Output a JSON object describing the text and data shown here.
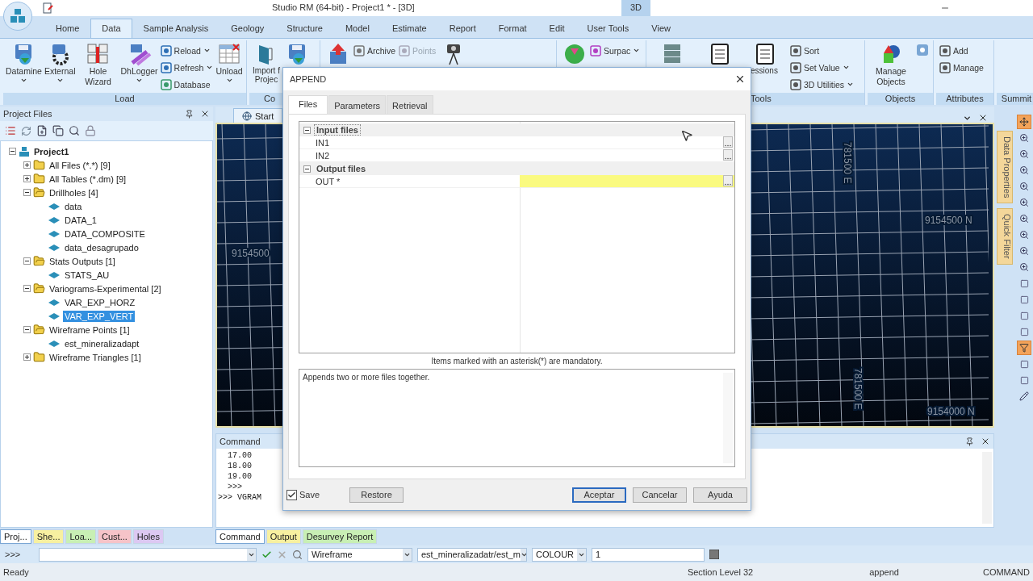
{
  "app": {
    "title": "Studio RM (64-bit) - Project1 * - [3D]",
    "context_tab": "3D"
  },
  "ribbon_tabs": [
    {
      "label": "Home",
      "selected": false
    },
    {
      "label": "Data",
      "selected": true
    },
    {
      "label": "Sample Analysis",
      "selected": false
    },
    {
      "label": "Geology",
      "selected": false
    },
    {
      "label": "Structure",
      "selected": false
    },
    {
      "label": "Model",
      "selected": false
    },
    {
      "label": "Estimate",
      "selected": false
    },
    {
      "label": "Report",
      "selected": false
    },
    {
      "label": "Format",
      "selected": false
    },
    {
      "label": "Edit",
      "selected": false
    },
    {
      "label": "User Tools",
      "selected": false
    },
    {
      "label": "View",
      "selected": false
    }
  ],
  "ribbon_groups": [
    {
      "label": "Load",
      "items": [
        {
          "kind": "large",
          "label": "Datamine",
          "dropdown": true
        },
        {
          "kind": "large",
          "label": "External",
          "dropdown": true
        },
        {
          "kind": "large",
          "label": "Hole Wizard",
          "dropdown": false
        },
        {
          "kind": "large",
          "label": "DhLogger",
          "dropdown": true
        },
        {
          "kind": "stack",
          "entries": [
            {
              "label": "Reload",
              "dropdown": true,
              "disabled": false
            },
            {
              "label": "Refresh",
              "dropdown": true,
              "disabled": false
            },
            {
              "label": "Database",
              "dropdown": false,
              "disabled": false
            }
          ]
        },
        {
          "kind": "large",
          "label": "Unload",
          "dropdown": true
        }
      ]
    },
    {
      "label": "Co",
      "items": [
        {
          "kind": "large",
          "label": "Import f Projec",
          "dropdown": false
        },
        {
          "kind": "icon"
        }
      ]
    },
    {
      "items": [
        {
          "kind": "icon"
        },
        {
          "kind": "stack",
          "entries": [
            {
              "label": "Archive",
              "dropdown": false,
              "disabled": false
            }
          ]
        },
        {
          "kind": "stack",
          "entries": [
            {
              "label": "Points",
              "dropdown": false,
              "disabled": true
            }
          ]
        },
        {
          "kind": "icon"
        }
      ]
    },
    {
      "items": [
        {
          "kind": "icon"
        },
        {
          "kind": "stack",
          "entries": [
            {
              "label": "Surpac",
              "dropdown": true,
              "disabled": false
            }
          ]
        }
      ]
    },
    {
      "label": "Tools",
      "items": [
        {
          "kind": "icon"
        },
        {
          "kind": "icon"
        },
        {
          "kind": "large",
          "label": "essions",
          "dropdown": false
        },
        {
          "kind": "stack",
          "entries": [
            {
              "label": "Sort",
              "dropdown": false,
              "disabled": false
            },
            {
              "label": "Set Value",
              "dropdown": true,
              "disabled": false
            },
            {
              "label": "3D Utilities",
              "dropdown": true,
              "disabled": false
            }
          ]
        }
      ]
    },
    {
      "label": "Objects",
      "items": [
        {
          "kind": "large",
          "label": "Manage Objects",
          "dropdown": false
        },
        {
          "kind": "icon"
        }
      ]
    },
    {
      "label": "Attributes",
      "items": [
        {
          "kind": "stack",
          "entries": [
            {
              "label": "Add",
              "dropdown": false,
              "disabled": false
            },
            {
              "label": "Manage",
              "dropdown": false,
              "disabled": false
            }
          ]
        }
      ]
    },
    {
      "label": "Summit"
    }
  ],
  "project_panel": {
    "title": "Project Files",
    "tree": [
      {
        "label": "Project1",
        "kind": "project",
        "expanded": true,
        "selected": false,
        "children": [
          {
            "label": "All Files (*.*) [9]",
            "kind": "folder",
            "expanded": false,
            "selected": false
          },
          {
            "label": "All Tables (*.dm) [9]",
            "kind": "folder",
            "expanded": false,
            "selected": false
          },
          {
            "label": "Drillholes [4]",
            "kind": "folder",
            "expanded": true,
            "selected": false,
            "children": [
              {
                "label": "data",
                "kind": "table",
                "selected": false
              },
              {
                "label": "DATA_1",
                "kind": "table",
                "selected": false
              },
              {
                "label": "DATA_COMPOSITE",
                "kind": "table",
                "selected": false
              },
              {
                "label": "data_desagrupado",
                "kind": "table",
                "selected": false
              }
            ]
          },
          {
            "label": "Stats Outputs [1]",
            "kind": "folder",
            "expanded": true,
            "selected": false,
            "children": [
              {
                "label": "STATS_AU",
                "kind": "table",
                "selected": false
              }
            ]
          },
          {
            "label": "Variograms-Experimental [2]",
            "kind": "folder",
            "expanded": true,
            "selected": false,
            "children": [
              {
                "label": "VAR_EXP_HORZ",
                "kind": "table",
                "selected": false
              },
              {
                "label": "VAR_EXP_VERT",
                "kind": "table",
                "selected": true
              }
            ]
          },
          {
            "label": "Wireframe Points [1]",
            "kind": "folder",
            "expanded": true,
            "selected": false,
            "children": [
              {
                "label": "est_mineralizadapt",
                "kind": "table",
                "selected": false
              }
            ]
          },
          {
            "label": "Wireframe Triangles [1]",
            "kind": "folder",
            "expanded": false,
            "selected": false
          }
        ]
      }
    ],
    "tabs": [
      {
        "label": "Proj...",
        "selected": true,
        "color": "#ffffff"
      },
      {
        "label": "She...",
        "selected": false,
        "color": "#f7f0a0"
      },
      {
        "label": "Loa...",
        "selected": false,
        "color": "#c8efb4"
      },
      {
        "label": "Cust...",
        "selected": false,
        "color": "#f6c3c8"
      },
      {
        "label": "Holes",
        "selected": false,
        "color": "#dcc8f2"
      }
    ]
  },
  "view": {
    "tab": "Start",
    "labels": [
      "9154500",
      "781500 E",
      "9154500 N",
      "781500 E",
      "9154000 N"
    ]
  },
  "side_tabs": [
    "Data Properties",
    "Quick Filter"
  ],
  "right_tools": [
    {
      "on": true
    },
    {
      "on": false
    },
    {
      "on": false
    },
    {
      "on": false
    },
    {
      "on": false
    },
    {
      "on": false
    },
    {
      "on": false
    },
    {
      "on": false
    },
    {
      "on": false
    },
    {
      "on": false
    },
    {
      "on": false
    },
    {
      "on": false
    },
    {
      "on": false
    },
    {
      "on": false
    },
    {
      "on": true
    },
    {
      "on": false
    },
    {
      "on": false
    },
    {
      "on": false
    }
  ],
  "command_panel": {
    "title": "Command",
    "lines": [
      "17.00",
      "18.00",
      "19.00",
      ">>>",
      ">>> VGRAM"
    ],
    "tabs": [
      {
        "label": "Command",
        "selected": true,
        "color": "#ffffff"
      },
      {
        "label": "Output",
        "selected": false,
        "color": "#f7f0a0"
      },
      {
        "label": "Desurvey Report",
        "selected": false,
        "color": "#c8efb4"
      }
    ]
  },
  "command_bar": {
    "prompt": ">>>",
    "object_type": "Wireframe",
    "object": "est_mineralizadatr/est_m",
    "attribute": "COLOUR",
    "value": "1"
  },
  "status_bar": {
    "message": "Ready",
    "section": "Section Level 32",
    "command": "append",
    "mode": "COMMAND"
  },
  "dialog": {
    "title": "APPEND",
    "tabs": [
      {
        "label": "Files",
        "selected": true
      },
      {
        "label": "Parameters",
        "selected": false
      },
      {
        "label": "Retrieval",
        "selected": false
      }
    ],
    "groups": [
      {
        "label": "Input files",
        "expanded": true,
        "focused": true,
        "rows": [
          {
            "name": "IN1",
            "mandatory": false
          },
          {
            "name": "IN2",
            "mandatory": false
          }
        ]
      },
      {
        "label": "Output files",
        "expanded": true,
        "focused": false,
        "rows": [
          {
            "name": "OUT *",
            "mandatory": true
          }
        ]
      }
    ],
    "note": "Items marked with an asterisk(*) are mandatory.",
    "description": "Appends two or more files together.",
    "save": {
      "label": "Save",
      "checked": true
    },
    "buttons": [
      {
        "label": "Restore",
        "default": false
      },
      {
        "label": "Aceptar",
        "default": true
      },
      {
        "label": "Cancelar",
        "default": false
      },
      {
        "label": "Ayuda",
        "default": false
      }
    ]
  }
}
